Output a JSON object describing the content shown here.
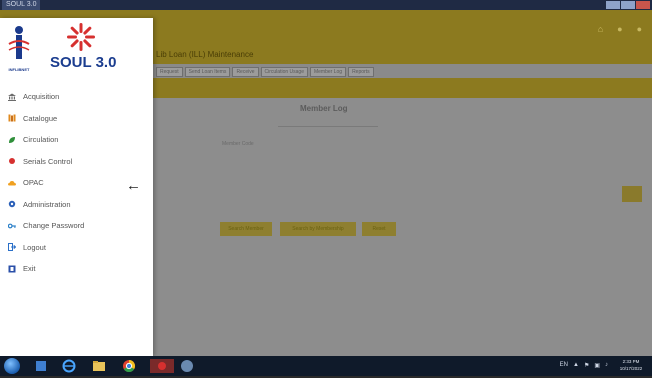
{
  "window": {
    "title": "SOUL 3.0"
  },
  "app": {
    "header_icons": [
      "home-icon",
      "user-icon",
      "help-icon"
    ],
    "module_title": "Lib Loan (ILL) Maintenance",
    "tabs": [
      {
        "label": "Request"
      },
      {
        "label": "Send Loan Items"
      },
      {
        "label": "Receive"
      },
      {
        "label": "Circulation Usage"
      },
      {
        "label": "Member Log"
      },
      {
        "label": "Reports"
      }
    ],
    "content_title": "Member Log",
    "field_label": "Member Code",
    "buttons": [
      {
        "label": "Search Member"
      },
      {
        "label": "Search by Membership"
      },
      {
        "label": "Reset"
      }
    ]
  },
  "drawer": {
    "brand": "SOUL 3.0",
    "logo_text": "INFLIBNET",
    "collapse_icon": "arrow-left-icon",
    "items": [
      {
        "label": "Acquisition",
        "icon": "bank-icon",
        "color": "#6b6b6b"
      },
      {
        "label": "Catalogue",
        "icon": "books-icon",
        "color": "#e08a1e"
      },
      {
        "label": "Circulation",
        "icon": "leaf-icon",
        "color": "#2f8f3a"
      },
      {
        "label": "Serials Control",
        "icon": "circle-icon",
        "color": "#d6302f"
      },
      {
        "label": "OPAC",
        "icon": "cloud-icon",
        "color": "#f0a020"
      },
      {
        "label": "Administration",
        "icon": "gear-icon",
        "color": "#2a5fb8"
      },
      {
        "label": "Change Password",
        "icon": "key-icon",
        "color": "#2a7fc8"
      },
      {
        "label": "Logout",
        "icon": "logout-icon",
        "color": "#2a6fc8"
      },
      {
        "label": "Exit",
        "icon": "exit-icon",
        "color": "#2a4fa8"
      }
    ]
  },
  "taskbar": {
    "tray_language": "EN",
    "time": "2:33 PM",
    "date": "10/17/2022"
  },
  "colors": {
    "brand_blue": "#1b3d8f",
    "header_gold": "#8c7a1f"
  }
}
